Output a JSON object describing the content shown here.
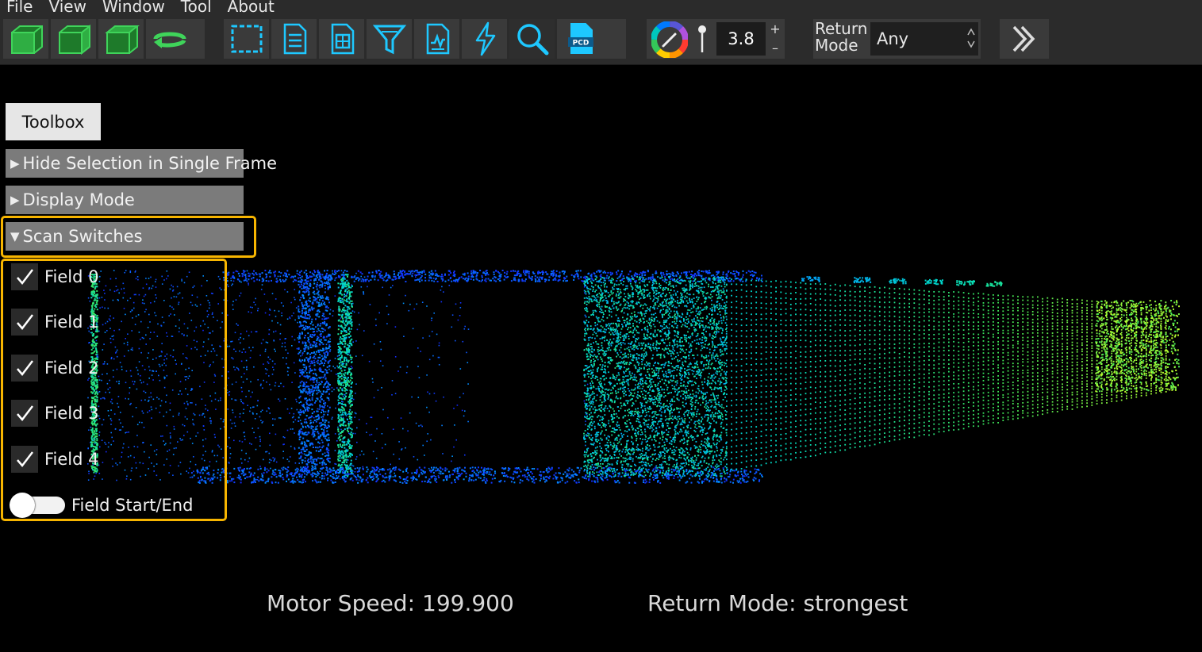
{
  "menu": [
    "File",
    "View",
    "Window",
    "Tool",
    "About"
  ],
  "toolbar": {
    "view_icons": [
      "cube-front-icon",
      "cube-side-icon",
      "cube-top-icon",
      "rotate-icon"
    ],
    "tool_icons": [
      "selection-box-icon",
      "list-document-icon",
      "grid-document-icon",
      "filter-icon",
      "chart-document-icon",
      "lightning-icon",
      "magnifier-icon",
      "pcd-file-icon"
    ],
    "point_size": "3.8",
    "inc_label": "+",
    "dec_label": "–",
    "return_mode_label_1": "Return",
    "return_mode_label_2": "Mode",
    "return_mode_value": "Any",
    "accent_color": "#00c8e8"
  },
  "panel": {
    "toolbox_label": "Toolbox",
    "sections": [
      {
        "label": "Hide Selection in Single Frame",
        "expanded": false
      },
      {
        "label": "Display Mode",
        "expanded": false
      },
      {
        "label": "Scan Switches",
        "expanded": true
      }
    ],
    "fields": [
      {
        "label": "Field 0",
        "checked": true
      },
      {
        "label": "Field 1",
        "checked": true
      },
      {
        "label": "Field 2",
        "checked": true
      },
      {
        "label": "Field 3",
        "checked": true
      },
      {
        "label": "Field 4",
        "checked": true
      }
    ],
    "toggle_label": "Field Start/End",
    "highlight_color": "#f7b500"
  },
  "status": {
    "motor_speed_label": "Motor Speed:",
    "motor_speed_value": "199.900",
    "return_mode_text": "Return Mode: strongest"
  }
}
